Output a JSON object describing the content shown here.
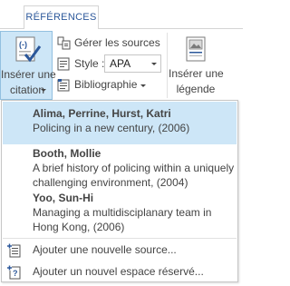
{
  "tab": {
    "label": "RÉFÉRENCES"
  },
  "ribbon": {
    "insert_citation": {
      "line1": "Insérer une",
      "line2": "citation"
    },
    "manage_sources": "Gérer les sources",
    "style": {
      "label": "Style :",
      "value": "APA"
    },
    "bibliography": "Bibliographie",
    "insert_caption": {
      "line1": "Insérer une",
      "line2": "légende"
    }
  },
  "citations": [
    {
      "author": "Alima, Perrine, Hurst, Katri",
      "desc": "Policing in a new century, (2006)",
      "selected": true
    },
    {
      "author": "Booth, Mollie",
      "desc": "A brief history of policing within a uniquely challenging environment, (2004)",
      "selected": false
    },
    {
      "author": "Yoo, Sun-Hi",
      "desc": "Managing a multidisciplanary team in Hong Kong, (2006)",
      "selected": false
    }
  ],
  "menu": {
    "add_source": "Ajouter une nouvelle source...",
    "add_placeholder": "Ajouter un nouvel espace réservé..."
  },
  "colors": {
    "accent": "#2b579a",
    "selection": "#cde6f7",
    "selection_border": "#92c0e0"
  },
  "icons": [
    "insert-citation-icon",
    "manage-sources-icon",
    "style-icon",
    "bibliography-icon",
    "insert-caption-icon",
    "add-source-icon",
    "add-placeholder-icon"
  ]
}
